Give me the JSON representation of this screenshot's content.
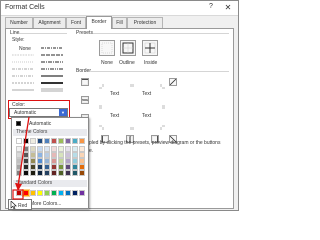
{
  "window": {
    "title": "Format Cells",
    "help": "?",
    "close": "✕"
  },
  "tabs": [
    {
      "label": "Number",
      "active": false
    },
    {
      "label": "Alignment",
      "active": false
    },
    {
      "label": "Font",
      "active": false
    },
    {
      "label": "Border",
      "active": true
    },
    {
      "label": "Fill",
      "active": false
    },
    {
      "label": "Protection",
      "active": false
    }
  ],
  "line": {
    "group_title": "Line",
    "style_label": "Style:",
    "none_label": "None",
    "color_label": "Color:",
    "color_value": "Automatic"
  },
  "presets": {
    "group_title": "Presets",
    "items": [
      {
        "label": "None"
      },
      {
        "label": "Outline"
      },
      {
        "label": "Inside"
      }
    ]
  },
  "border": {
    "group_title": "Border",
    "preview_text": [
      "Text",
      "Text",
      "Text",
      "Text"
    ]
  },
  "hint_text": "pled by clicking the presets, preview diagram or the buttons",
  "hint_text_2": "e.",
  "color_popup": {
    "automatic_label": "Automatic",
    "theme_title": "Theme Colors",
    "standard_title": "Standard Colors",
    "more_label": "More Colors...",
    "selected_tooltip": "Red",
    "theme_top_row": [
      "#ffffff",
      "#000000",
      "#eeece1",
      "#1f497d",
      "#4f81bd",
      "#c0504d",
      "#9bbb59",
      "#8064a2",
      "#4bacc6",
      "#f79646"
    ],
    "theme_shades": [
      [
        "#f2f2f2",
        "#d9d9d9",
        "#bfbfbf",
        "#a6a6a6",
        "#7f7f7f"
      ],
      [
        "#7f7f7f",
        "#595959",
        "#3f3f3f",
        "#262626",
        "#0d0d0d"
      ],
      [
        "#ddd9c3",
        "#c4bd97",
        "#938953",
        "#494429",
        "#1d1b10"
      ],
      [
        "#c6d9f0",
        "#8db3e2",
        "#548dd4",
        "#17365d",
        "#0f243e"
      ],
      [
        "#dbe5f1",
        "#b8cce4",
        "#95b3d7",
        "#366092",
        "#244061"
      ],
      [
        "#f2dcdb",
        "#e5b9b7",
        "#d99694",
        "#953734",
        "#632423"
      ],
      [
        "#ebf1dd",
        "#d7e3bc",
        "#c3d69b",
        "#76923c",
        "#4f6128"
      ],
      [
        "#e5e0ec",
        "#ccc1d9",
        "#b2a2c7",
        "#5f497a",
        "#3f3151"
      ],
      [
        "#dbeef3",
        "#b7dde8",
        "#92cddc",
        "#31859b",
        "#205867"
      ],
      [
        "#fdeada",
        "#fbd5b5",
        "#fac08f",
        "#e36c09",
        "#974806"
      ]
    ],
    "standard_row": [
      "#c00000",
      "#ff0000",
      "#ffc000",
      "#ffff00",
      "#92d050",
      "#00b050",
      "#00b0f0",
      "#0070c0",
      "#002060",
      "#7030a0"
    ],
    "selected_index": 1
  },
  "accent": {
    "highlight_red": "#dd1111",
    "select_blue": "#3a6ad4"
  }
}
